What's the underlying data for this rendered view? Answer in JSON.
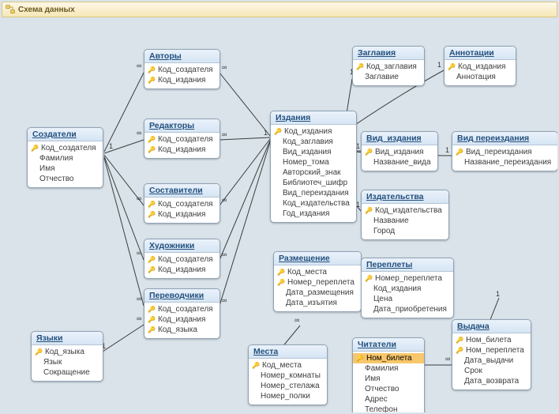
{
  "window": {
    "title": "Схема данных"
  },
  "tables": {
    "sozdateli": {
      "title": "Создатели",
      "fields": [
        "Код_создателя",
        "Фамилия",
        "Имя",
        "Отчество"
      ],
      "pk": [
        0
      ]
    },
    "yazyki": {
      "title": "Языки",
      "fields": [
        "Код_языка",
        "Язык",
        "Сокращение"
      ],
      "pk": [
        0
      ]
    },
    "avtory": {
      "title": "Авторы",
      "fields": [
        "Код_создателя",
        "Код_издания"
      ],
      "pk": [
        0,
        1
      ]
    },
    "redaktory": {
      "title": "Редакторы",
      "fields": [
        "Код_создателя",
        "Код_издания"
      ],
      "pk": [
        0,
        1
      ]
    },
    "sostaviteli": {
      "title": "Составители",
      "fields": [
        "Код_создателя",
        "Код_издания"
      ],
      "pk": [
        0,
        1
      ]
    },
    "hudozhniki": {
      "title": "Художники",
      "fields": [
        "Код_создателя",
        "Код_издания"
      ],
      "pk": [
        0,
        1
      ]
    },
    "perevodchiki": {
      "title": "Переводчики",
      "fields": [
        "Код_создателя",
        "Код_издания",
        "Код_языка"
      ],
      "pk": [
        0,
        1,
        2
      ]
    },
    "izdaniya": {
      "title": "Издания",
      "fields": [
        "Код_издания",
        "Код_заглавия",
        "Вид_издания",
        "Номер_тома",
        "Авторский_знак",
        "Библиотеч_шифр",
        "Вид_переиздания",
        "Код_издательства",
        "Год_издания"
      ],
      "pk": [
        0
      ]
    },
    "zaglaviya": {
      "title": "Заглавия",
      "fields": [
        "Код_заглавия",
        "Заглавие"
      ],
      "pk": [
        0
      ]
    },
    "annotacii": {
      "title": "Аннотации",
      "fields": [
        "Код_издания",
        "Аннотация"
      ],
      "pk": [
        0
      ]
    },
    "vid_izdaniya": {
      "title": "Вид_издания",
      "fields": [
        "Вид_издания",
        "Название_вида"
      ],
      "pk": [
        0
      ]
    },
    "vid_pereizdaniya": {
      "title": "Вид переиздания",
      "fields": [
        "Вид_переиздания",
        "Название_переиздания"
      ],
      "pk": [
        0
      ]
    },
    "izdatelstva": {
      "title": "Издательства",
      "fields": [
        "Код_издательства",
        "Название",
        "Город"
      ],
      "pk": [
        0
      ]
    },
    "razmeshenie": {
      "title": "Размещение",
      "fields": [
        "Код_места",
        "Номер_переплета",
        "Дата_размещения",
        "Дата_изъятия"
      ],
      "pk": [
        0,
        1
      ]
    },
    "mesta": {
      "title": "Места",
      "fields": [
        "Код_места",
        "Номер_комнаты",
        "Номер_стелажа",
        "Номер_полки"
      ],
      "pk": [
        0
      ]
    },
    "pereplety": {
      "title": "Переплеты",
      "fields": [
        "Номер_переплета",
        "Код_издания",
        "Цена",
        "Дата_приобретения"
      ],
      "pk": [
        0
      ]
    },
    "chitateli": {
      "title": "Читатели",
      "fields": [
        "Ном_билета",
        "Фамилия",
        "Имя",
        "Отчество",
        "Адрес",
        "Телефон"
      ],
      "pk": [
        0
      ],
      "selected": 0
    },
    "vydacha": {
      "title": "Выдача",
      "fields": [
        "Ном_билета",
        "Ном_переплета",
        "Дата_выдачи",
        "Срок",
        "Дата_возврата"
      ],
      "pk": [
        0,
        1
      ]
    }
  },
  "cardinality": {
    "one": "1",
    "many": "∞"
  }
}
